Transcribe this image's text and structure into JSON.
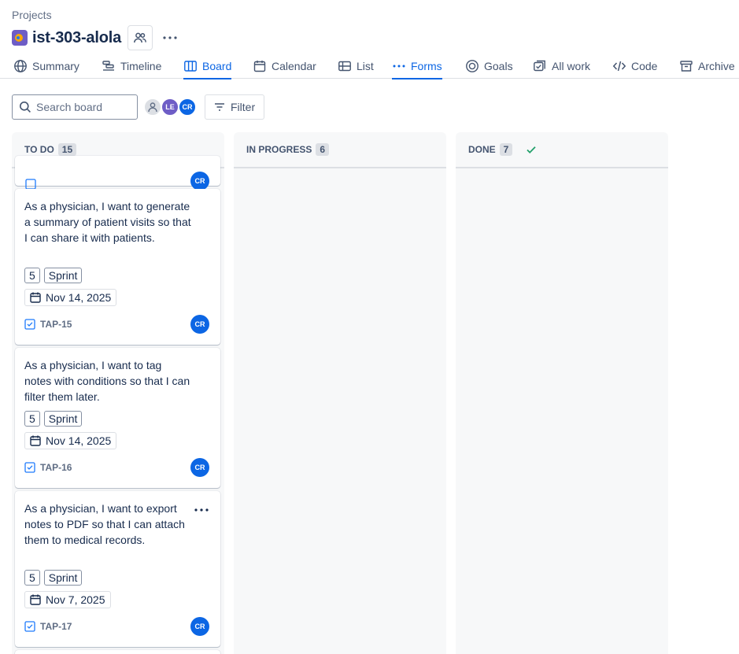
{
  "breadcrumb": "Projects",
  "project": {
    "title": "ist-303-alola"
  },
  "tabs": [
    {
      "label": "Summary",
      "icon": "globe-icon"
    },
    {
      "label": "Timeline",
      "icon": "timeline-icon"
    },
    {
      "label": "Board",
      "icon": "board-icon",
      "active": true
    },
    {
      "label": "Calendar",
      "icon": "calendar-icon"
    },
    {
      "label": "List",
      "icon": "list-icon"
    },
    {
      "label": "Forms",
      "icon": "dots-icon",
      "active_underline": true
    },
    {
      "label": "Goals",
      "icon": "goal-icon"
    },
    {
      "label": "All work",
      "icon": "all-work-icon"
    },
    {
      "label": "Code",
      "icon": "code-icon"
    },
    {
      "label": "Archive",
      "icon": "archive-icon"
    }
  ],
  "toolbar": {
    "search_placeholder": "Search board",
    "avatars": [
      "LE",
      "CR"
    ],
    "filter_label": "Filter"
  },
  "columns": [
    {
      "name": "TO DO",
      "count": "15"
    },
    {
      "name": "IN PROGRESS",
      "count": "6"
    },
    {
      "name": "DONE",
      "count": "7"
    }
  ],
  "cards": [
    {
      "text": "As a physician, I want to generate a summary of patient visits so that I can share it with patients.",
      "points": "5",
      "label": "Sprint",
      "date": "Nov 14, 2025",
      "key": "TAP-15",
      "assignee": "CR"
    },
    {
      "text": "As a physician, I want to tag notes with conditions so that I can filter them later.",
      "points": "5",
      "label": "Sprint",
      "date": "Nov 14, 2025",
      "key": "TAP-16",
      "assignee": "CR"
    },
    {
      "text": "As a physician, I want to export notes to PDF so that I can attach them to medical records.",
      "points": "5",
      "label": "Sprint",
      "date": "Nov 7, 2025",
      "key": "TAP-17",
      "assignee": "CR"
    }
  ],
  "colors": {
    "accent": "#0c66e4",
    "done_check": "#22a06b"
  }
}
